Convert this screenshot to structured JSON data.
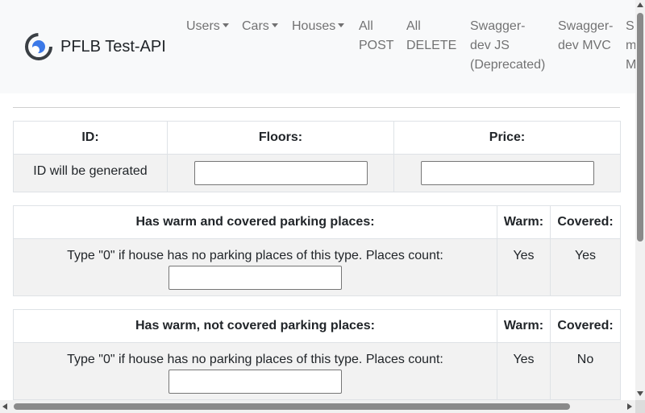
{
  "navbar": {
    "brand": "PFLB Test-API",
    "items": [
      {
        "label": "Users"
      },
      {
        "label": "Cars"
      },
      {
        "label": "Houses"
      },
      {
        "line1": "All",
        "line2": "POST"
      },
      {
        "line1": "All",
        "line2": "DELETE"
      },
      {
        "line1": "Swagger-",
        "line2": "dev JS",
        "line3": "(Deprecated)"
      },
      {
        "line1": "Swagger-",
        "line2": "dev MVC"
      },
      {
        "line1": "S",
        "line2": "m",
        "line3": "M"
      }
    ]
  },
  "table1": {
    "headers": [
      "ID:",
      "Floors:",
      "Price:"
    ],
    "id_value": "ID will be generated",
    "floors_value": "",
    "price_value": ""
  },
  "table2": {
    "headers": [
      "Has warm and covered parking places:",
      "Warm:",
      "Covered:"
    ],
    "hint": "Type \"0\" if house has no parking places of this type. Places count:",
    "count_value": "",
    "warm": "Yes",
    "covered": "Yes"
  },
  "table3": {
    "headers": [
      "Has warm, not covered parking places:",
      "Warm:",
      "Covered:"
    ],
    "hint": "Type \"0\" if house has no parking places of this type. Places count:",
    "count_value": "",
    "warm": "Yes",
    "covered": "No"
  },
  "colors": {
    "navbar_bg": "#f8f9fa",
    "row_bg": "#f2f2f2",
    "brand_accent": "#3b78e7"
  }
}
